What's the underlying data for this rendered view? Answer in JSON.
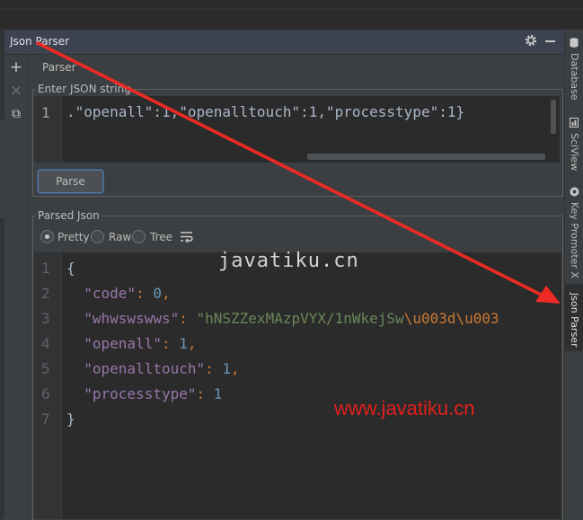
{
  "window": {
    "title": "Json Parser"
  },
  "toolbar": {
    "add_icon": "+",
    "close_icon": "×",
    "copy_icon": "⧉"
  },
  "tab": {
    "label": "Parser"
  },
  "input": {
    "group_title": "Enter JSON string",
    "line_number": "1",
    "text": ".\"openall\":1,\"openalltouch\":1,\"processtype\":1}"
  },
  "parse_button": {
    "label": "Parse"
  },
  "output": {
    "group_title": "Parsed Json",
    "view_modes": [
      {
        "label": "Pretty",
        "selected": true
      },
      {
        "label": "Raw",
        "selected": false
      },
      {
        "label": "Tree",
        "selected": false
      }
    ],
    "lines": [
      {
        "num": "1",
        "tokens": [
          {
            "t": "{",
            "c": "#a9b7c6"
          }
        ]
      },
      {
        "num": "2",
        "tokens": [
          {
            "t": "  \"code\"",
            "c": "#9876aa"
          },
          {
            "t": ": ",
            "c": "#cc7832"
          },
          {
            "t": "0",
            "c": "#6897bb"
          },
          {
            "t": ",",
            "c": "#cc7832"
          }
        ]
      },
      {
        "num": "3",
        "tokens": [
          {
            "t": "  \"whwswswws\"",
            "c": "#9876aa"
          },
          {
            "t": ": ",
            "c": "#cc7832"
          },
          {
            "t": "\"hNSZZexMAzpVYX/1nWkejSw",
            "c": "#6a8759"
          },
          {
            "t": "\\u003d\\u003",
            "c": "#cc7832"
          }
        ]
      },
      {
        "num": "4",
        "tokens": [
          {
            "t": "  \"openall\"",
            "c": "#9876aa"
          },
          {
            "t": ": ",
            "c": "#cc7832"
          },
          {
            "t": "1",
            "c": "#6897bb"
          },
          {
            "t": ",",
            "c": "#cc7832"
          }
        ]
      },
      {
        "num": "5",
        "tokens": [
          {
            "t": "  \"openalltouch\"",
            "c": "#9876aa"
          },
          {
            "t": ": ",
            "c": "#cc7832"
          },
          {
            "t": "1",
            "c": "#6897bb"
          },
          {
            "t": ",",
            "c": "#cc7832"
          }
        ]
      },
      {
        "num": "6",
        "tokens": [
          {
            "t": "  \"processtype\"",
            "c": "#9876aa"
          },
          {
            "t": ": ",
            "c": "#cc7832"
          },
          {
            "t": "1",
            "c": "#6897bb"
          }
        ]
      },
      {
        "num": "7",
        "tokens": [
          {
            "t": "}",
            "c": "#a9b7c6"
          }
        ]
      }
    ]
  },
  "right_tool_windows": [
    {
      "label": "Database",
      "active": false
    },
    {
      "label": "SciView",
      "active": false
    },
    {
      "label": "Key Promoter X",
      "active": false
    },
    {
      "label": "Json Parser",
      "active": true
    }
  ],
  "watermarks": {
    "top": "javatiku.cn",
    "bottom": "www.javatiku.cn"
  },
  "colors": {
    "accent": "#3d6185",
    "arrow": "#ee2a24"
  }
}
